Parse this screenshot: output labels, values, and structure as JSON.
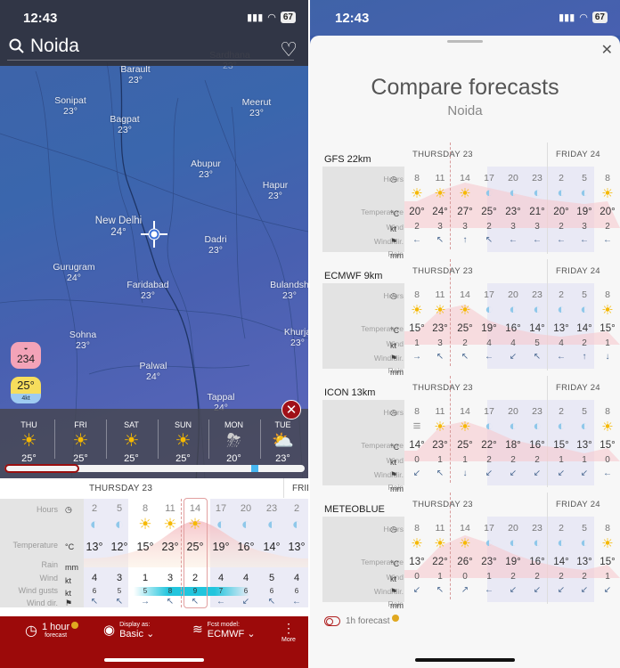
{
  "status_bar": {
    "time": "12:43",
    "battery": "67"
  },
  "search": {
    "location": "Noida"
  },
  "map": {
    "cities": [
      {
        "name": "Barault",
        "temp": "23°"
      },
      {
        "name": "Sardhana",
        "temp": "23°"
      },
      {
        "name": "Sonipat",
        "temp": "23°"
      },
      {
        "name": "Bagpat",
        "temp": "23°"
      },
      {
        "name": "Meerut",
        "temp": "23°"
      },
      {
        "name": "Abupur",
        "temp": "23°"
      },
      {
        "name": "Hapur",
        "temp": "23°"
      },
      {
        "name": "New Delhi",
        "temp": "24°"
      },
      {
        "name": "Dadri",
        "temp": "23°"
      },
      {
        "name": "Gurugram",
        "temp": "24°"
      },
      {
        "name": "Faridabad",
        "temp": "23°"
      },
      {
        "name": "Bulandsh",
        "temp": "23°"
      },
      {
        "name": "Sohna",
        "temp": "23°"
      },
      {
        "name": "Khurja",
        "temp": "23°"
      },
      {
        "name": "Palwal",
        "temp": "24°"
      },
      {
        "name": "Tappal",
        "temp": "24°"
      }
    ],
    "aqi_badge": "234",
    "temp_badge": {
      "temp": "25°",
      "wind": "4kt"
    }
  },
  "days": [
    {
      "name": "THU",
      "icon": "partly-sunny-fog",
      "temp": "25°"
    },
    {
      "name": "FRI",
      "icon": "sun",
      "temp": "25°"
    },
    {
      "name": "SAT",
      "icon": "sun",
      "temp": "25°"
    },
    {
      "name": "SUN",
      "icon": "sun",
      "temp": "25°"
    },
    {
      "name": "MON",
      "icon": "thunder-rain",
      "temp": "20°"
    },
    {
      "name": "TUE",
      "icon": "partly-cloudy",
      "temp": "23°"
    }
  ],
  "forecast": {
    "day_label": "THURSDAY 23",
    "next_day_label": "FRID",
    "labels": {
      "hours": "Hours",
      "temperature": "Temperature",
      "temp_unit": "°C",
      "rain": "Rain",
      "rain_unit": "mm",
      "wind": "Wind",
      "wind_unit": "kt",
      "gusts": "Wind gusts",
      "gusts_unit": "kt",
      "wind_dir": "Wind dir."
    },
    "hours": [
      "2",
      "5",
      "8",
      "11",
      "14",
      "17",
      "20",
      "23",
      "2"
    ],
    "icons": [
      "moon",
      "moon",
      "sun-fog",
      "sun",
      "sun",
      "moon",
      "moon",
      "moon",
      "moon"
    ],
    "temps": [
      "13°",
      "12°",
      "15°",
      "23°",
      "25°",
      "19°",
      "16°",
      "14°",
      "13°"
    ],
    "wind": [
      "4",
      "3",
      "1",
      "3",
      "2",
      "4",
      "4",
      "5",
      "4"
    ],
    "gusts": [
      "6",
      "5",
      "5",
      "8",
      "9",
      "7",
      "6",
      "6",
      "6"
    ],
    "wind_dir": [
      "↖",
      "↖",
      "→",
      "↖",
      "↖",
      "←",
      "↙",
      "↖",
      "←"
    ],
    "selected_hour": "14"
  },
  "bottom_bar": {
    "forecast_step": "1 hour",
    "forecast_sub": "forecast",
    "display_label": "Display as:",
    "display_value": "Basic",
    "model_label": "Fcst model:",
    "model_value": "ECMWF",
    "more_label": "More"
  },
  "compare": {
    "title": "Compare forecasts",
    "location": "Noida",
    "labels": {
      "hours": "Hours",
      "temperature": "Temperature",
      "temp_unit": "°C",
      "wind": "Wind",
      "wind_unit": "kt",
      "wind_dir": "Wind dir.",
      "rain": "Rain",
      "rain_unit": "mm"
    },
    "day1": "THURSDAY 23",
    "day2": "FRIDAY 24",
    "hours": [
      "8",
      "11",
      "14",
      "17",
      "20",
      "23",
      "2",
      "5",
      "8"
    ],
    "models": [
      {
        "name": "GFS 22km",
        "icons": [
          "sun",
          "sun",
          "sun",
          "moon",
          "moon",
          "moon",
          "moon",
          "moon",
          "sun"
        ],
        "temps": [
          "20°",
          "24°",
          "27°",
          "25°",
          "23°",
          "21°",
          "20°",
          "19°",
          "20°"
        ],
        "wind": [
          "2",
          "3",
          "3",
          "2",
          "3",
          "3",
          "2",
          "3",
          "2"
        ],
        "wind_dir": [
          "←",
          "↖",
          "↑",
          "↖",
          "←",
          "←",
          "←",
          "←",
          "←"
        ]
      },
      {
        "name": "ECMWF 9km",
        "icons": [
          "sun-fog",
          "sun",
          "sun",
          "moon",
          "moon",
          "moon",
          "moon",
          "moon",
          "sun"
        ],
        "temps": [
          "15°",
          "23°",
          "25°",
          "19°",
          "16°",
          "14°",
          "13°",
          "14°",
          "15°"
        ],
        "wind": [
          "1",
          "3",
          "2",
          "4",
          "4",
          "5",
          "4",
          "2",
          "1"
        ],
        "wind_dir": [
          "→",
          "↖",
          "↖",
          "←",
          "↙",
          "↖",
          "←",
          "↑",
          "↓"
        ]
      },
      {
        "name": "ICON 13km",
        "icons": [
          "fog",
          "sun",
          "sun",
          "moon",
          "moon",
          "moon",
          "moon",
          "moon",
          "sun"
        ],
        "temps": [
          "14°",
          "23°",
          "25°",
          "22°",
          "18°",
          "16°",
          "15°",
          "13°",
          "15°"
        ],
        "wind": [
          "0",
          "1",
          "1",
          "2",
          "2",
          "2",
          "1",
          "1",
          "0"
        ],
        "wind_dir": [
          "↙",
          "↖",
          "↓",
          "↙",
          "↙",
          "↙",
          "↙",
          "↙",
          "←"
        ]
      },
      {
        "name": "METEOBLUE",
        "icons": [
          "sun",
          "sun",
          "sun",
          "moon",
          "moon",
          "moon",
          "moon",
          "moon",
          "sun"
        ],
        "temps": [
          "13°",
          "22°",
          "26°",
          "23°",
          "19°",
          "16°",
          "14°",
          "13°",
          "15°"
        ],
        "wind": [
          "0",
          "1",
          "0",
          "1",
          "2",
          "2",
          "2",
          "2",
          "1"
        ],
        "wind_dir": [
          "↙",
          "↖",
          "↗",
          "←",
          "↙",
          "↙",
          "↙",
          "↙",
          "↙"
        ]
      }
    ],
    "toggle_label": "1h forecast"
  }
}
